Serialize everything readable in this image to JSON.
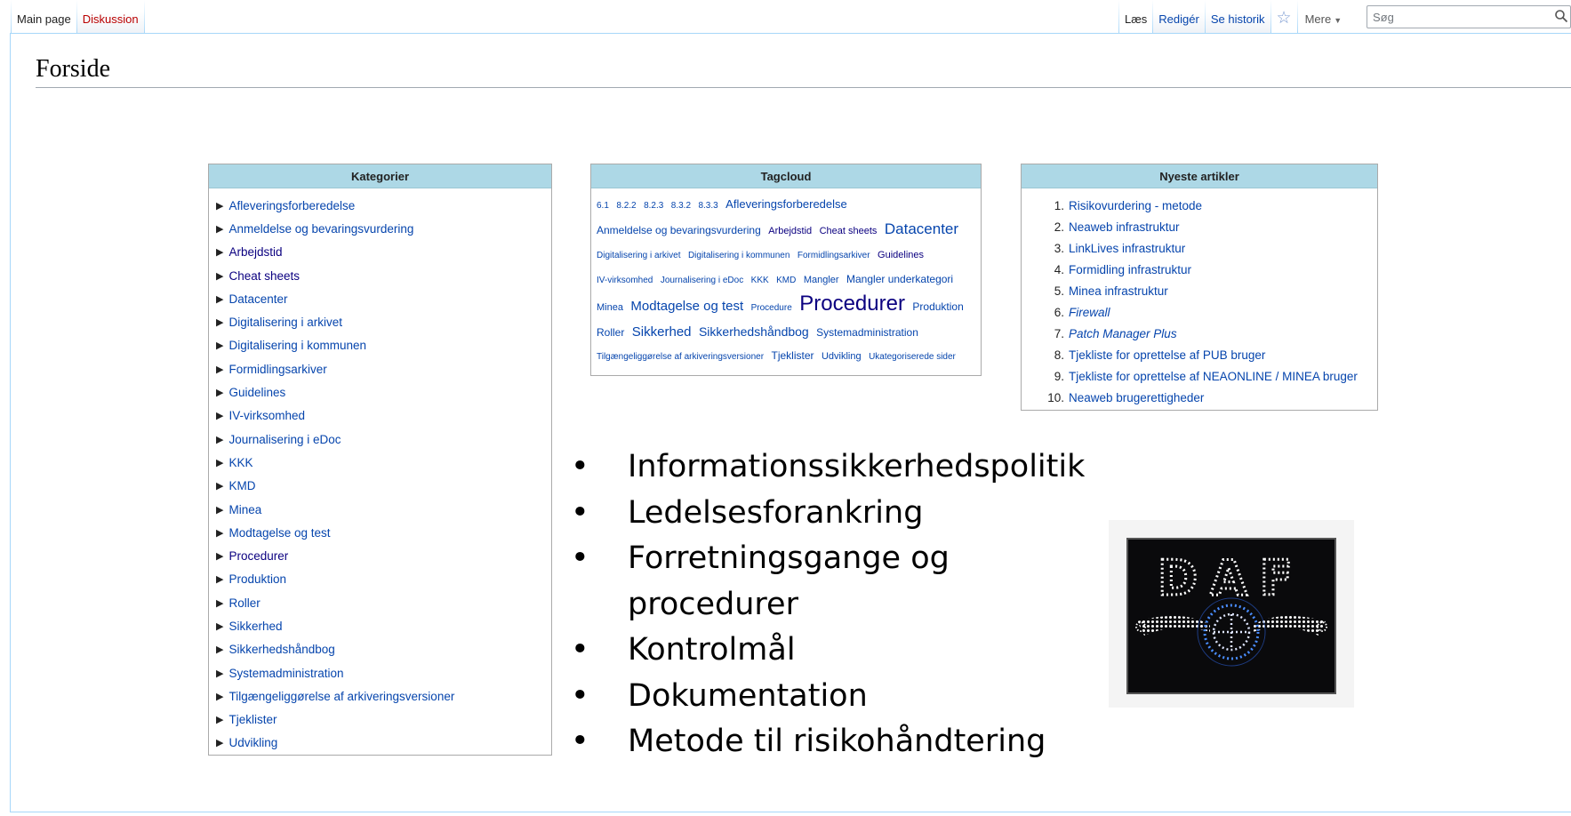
{
  "left_tabs": [
    {
      "label": "Main page",
      "state": "selected"
    },
    {
      "label": "Diskussion",
      "state": "new"
    }
  ],
  "right_tabs": {
    "read": "Læs",
    "edit": "Redigér",
    "history": "Se historik",
    "more": "Mere"
  },
  "search": {
    "placeholder": "Søg"
  },
  "page": {
    "title": "Forside"
  },
  "categories": {
    "header": "Kategorier",
    "items": [
      "Afleveringsforberedelse",
      "Anmeldelse og bevaringsvurdering",
      "Arbejdstid",
      "Cheat sheets",
      "Datacenter",
      "Digitalisering i arkivet",
      "Digitalisering i kommunen",
      "Formidlingsarkiver",
      "Guidelines",
      "IV-virksomhed",
      "Journalisering i eDoc",
      "KKK",
      "KMD",
      "Minea",
      "Modtagelse og test",
      "Procedurer",
      "Produktion",
      "Roller",
      "Sikkerhed",
      "Sikkerhedshåndbog",
      "Systemadministration",
      "Tilgængeliggørelse af arkiveringsversioner",
      "Tjeklister",
      "Udvikling"
    ]
  },
  "tagcloud": {
    "header": "Tagcloud",
    "tags": [
      {
        "label": "6.1",
        "size": 10
      },
      {
        "label": "8.2.2",
        "size": 10
      },
      {
        "label": "8.2.3",
        "size": 10
      },
      {
        "label": "8.3.2",
        "size": 10
      },
      {
        "label": "8.3.3",
        "size": 10
      },
      {
        "label": "Afleveringsforberedelse",
        "size": 13
      },
      {
        "label": "Anmeldelse og bevaringsvurdering",
        "size": 12
      },
      {
        "label": "Arbejdstid",
        "size": 11,
        "tone": "dark"
      },
      {
        "label": "Cheat sheets",
        "size": 11,
        "tone": "dark"
      },
      {
        "label": "Datacenter",
        "size": 17
      },
      {
        "label": "Digitalisering i arkivet",
        "size": 10
      },
      {
        "label": "Digitalisering i kommunen",
        "size": 10
      },
      {
        "label": "Formidlingsarkiver",
        "size": 10
      },
      {
        "label": "Guidelines",
        "size": 11,
        "tone": "dark"
      },
      {
        "label": "IV-virksomhed",
        "size": 10
      },
      {
        "label": "Journalisering i eDoc",
        "size": 10
      },
      {
        "label": "KKK",
        "size": 10
      },
      {
        "label": "KMD",
        "size": 10
      },
      {
        "label": "Mangler",
        "size": 11
      },
      {
        "label": "Mangler underkategori",
        "size": 12
      },
      {
        "label": "Minea",
        "size": 11
      },
      {
        "label": "Modtagelse og test",
        "size": 15
      },
      {
        "label": "Procedure",
        "size": 10
      },
      {
        "label": "Procedurer",
        "size": 24,
        "tone": "dark"
      },
      {
        "label": "Produktion",
        "size": 12
      },
      {
        "label": "Roller",
        "size": 12
      },
      {
        "label": "Sikkerhed",
        "size": 15
      },
      {
        "label": "Sikkerhedshåndbog",
        "size": 14
      },
      {
        "label": "Systemadministration",
        "size": 12
      },
      {
        "label": "Tilgængeliggørelse af arkiveringsversioner",
        "size": 10
      },
      {
        "label": "Tjeklister",
        "size": 12
      },
      {
        "label": "Udvikling",
        "size": 11
      },
      {
        "label": "Ukategoriserede sider",
        "size": 10
      }
    ]
  },
  "newest": {
    "header": "Nyeste artikler",
    "items": [
      {
        "n": "1.",
        "label": "Risikovurdering - metode",
        "italic": false
      },
      {
        "n": "2.",
        "label": "Neaweb infrastruktur",
        "italic": false
      },
      {
        "n": "3.",
        "label": "LinkLives infrastruktur",
        "italic": false
      },
      {
        "n": "4.",
        "label": "Formidling infrastruktur",
        "italic": false
      },
      {
        "n": "5.",
        "label": "Minea infrastruktur",
        "italic": false
      },
      {
        "n": "6.",
        "label": "Firewall",
        "italic": true
      },
      {
        "n": "7.",
        "label": "Patch Manager Plus",
        "italic": true
      },
      {
        "n": "8.",
        "label": "Tjekliste for oprettelse af PUB bruger",
        "italic": false
      },
      {
        "n": "9.",
        "label": "Tjekliste for oprettelse af NEAONLINE / MINEA bruger",
        "italic": false
      },
      {
        "n": "10.",
        "label": "Neaweb brugerettigheder",
        "italic": false
      }
    ]
  },
  "bullets": [
    "Informationssikkerhedspolitik",
    "Ledelsesforankring",
    "Forretningsgange og procedurer",
    "Kontrolmål",
    "Dokumentation",
    "Metode til risikohåndtering"
  ],
  "logo": {
    "text": "DAF",
    "colors": {
      "letters": "#ffffff",
      "wings": "#dfe6ff",
      "emblem": "#3a7bff"
    }
  }
}
